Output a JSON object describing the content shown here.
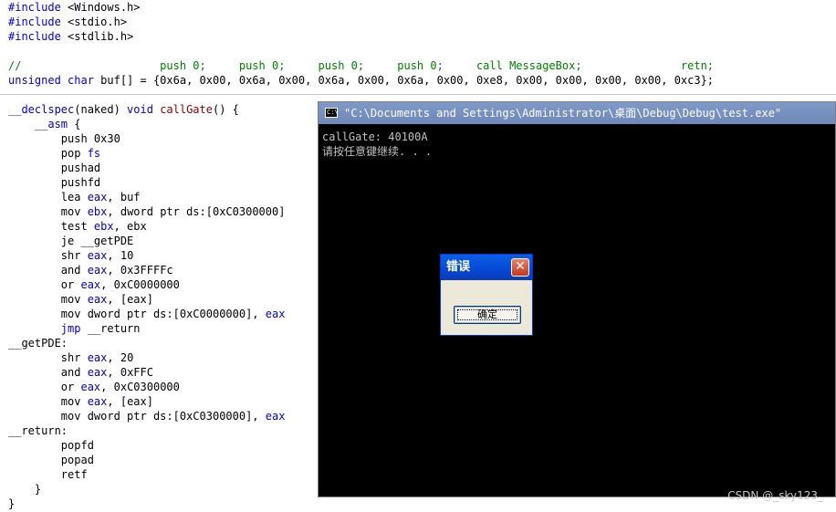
{
  "code": {
    "include_kw": "#include",
    "include_1": " <Windows.h>",
    "include_2": " <stdio.h>",
    "include_3": " <stdlib.h>",
    "comment_line": "//                     push 0;     push 0;     push 0;     push 0;     call MessageBox;               retn;",
    "buf_decl_type": "unsigned char",
    "buf_decl_rest": " buf[] = {0x6a, 0x00, 0x6a, 0x00, 0x6a, 0x00, 0x6a, 0x00, 0xe8, 0x00, 0x00, 0x00, 0x00, 0xc3};",
    "func_declspec": "__declspec",
    "func_naked": "(naked) ",
    "func_void": "void",
    "func_name": "callGate",
    "func_tail": "() {",
    "asm_open_kw": "    __asm",
    "asm_open_brace": " {",
    "asm_lines": [
      {
        "a": "        push 0x30",
        "b": "",
        "c": ""
      },
      {
        "a": "        pop ",
        "b": "fs",
        "c": ""
      },
      {
        "a": "        pushad",
        "b": "",
        "c": ""
      },
      {
        "a": "        pushfd",
        "b": "",
        "c": ""
      },
      {
        "a": "        lea ",
        "b": "eax",
        "c": ", buf"
      },
      {
        "a": "        mov ",
        "b": "ebx",
        "c": ", dword ptr ds:[0xC0300000]"
      },
      {
        "a": "        test ",
        "b": "ebx",
        "c": ", ebx"
      },
      {
        "a": "        je __getPDE",
        "b": "",
        "c": ""
      },
      {
        "a": "        shr ",
        "b": "eax",
        "c": ", 10"
      },
      {
        "a": "        and ",
        "b": "eax",
        "c": ", 0x3FFFFc"
      },
      {
        "a": "        or ",
        "b": "eax",
        "c": ", 0xC0000000"
      },
      {
        "a": "        mov ",
        "b": "eax",
        "c": ", [eax]"
      },
      {
        "a": "        mov dword ptr ds:[0xC0000000], ",
        "b": "eax",
        "c": ""
      },
      {
        "a": "        jmp",
        "b": "",
        "c": " __return"
      }
    ],
    "label_getpde": "__getPDE:",
    "asm_lines_2": [
      {
        "a": "        shr ",
        "b": "eax",
        "c": ", 20"
      },
      {
        "a": "        and ",
        "b": "eax",
        "c": ", 0xFFC"
      },
      {
        "a": "        or ",
        "b": "eax",
        "c": ", 0xC0300000"
      },
      {
        "a": "        mov ",
        "b": "eax",
        "c": ", [eax]"
      },
      {
        "a": "        mov dword ptr ds:[0xC0300000], ",
        "b": "eax",
        "c": ""
      }
    ],
    "label_return": "__return:",
    "asm_lines_3": [
      "        popfd",
      "        popad",
      "        retf"
    ],
    "close_asm": "    }",
    "close_func": "}"
  },
  "console": {
    "icon_text": "C:\\",
    "title": "\"C:\\Documents and Settings\\Administrator\\桌面\\Debug\\Debug\\test.exe\"",
    "line1": "callGate: 40100A",
    "line2": "请按任意键继续. . ."
  },
  "dialog": {
    "title": "错误",
    "close_glyph": "✕",
    "ok_label": "确定"
  },
  "watermark": "CSDN @_sky123_",
  "colors": {
    "keyword": "#0000c8",
    "comment": "#008000",
    "function": "#8b0000",
    "dialog_titlebar": "#0548d1",
    "console_bg": "#000000"
  }
}
